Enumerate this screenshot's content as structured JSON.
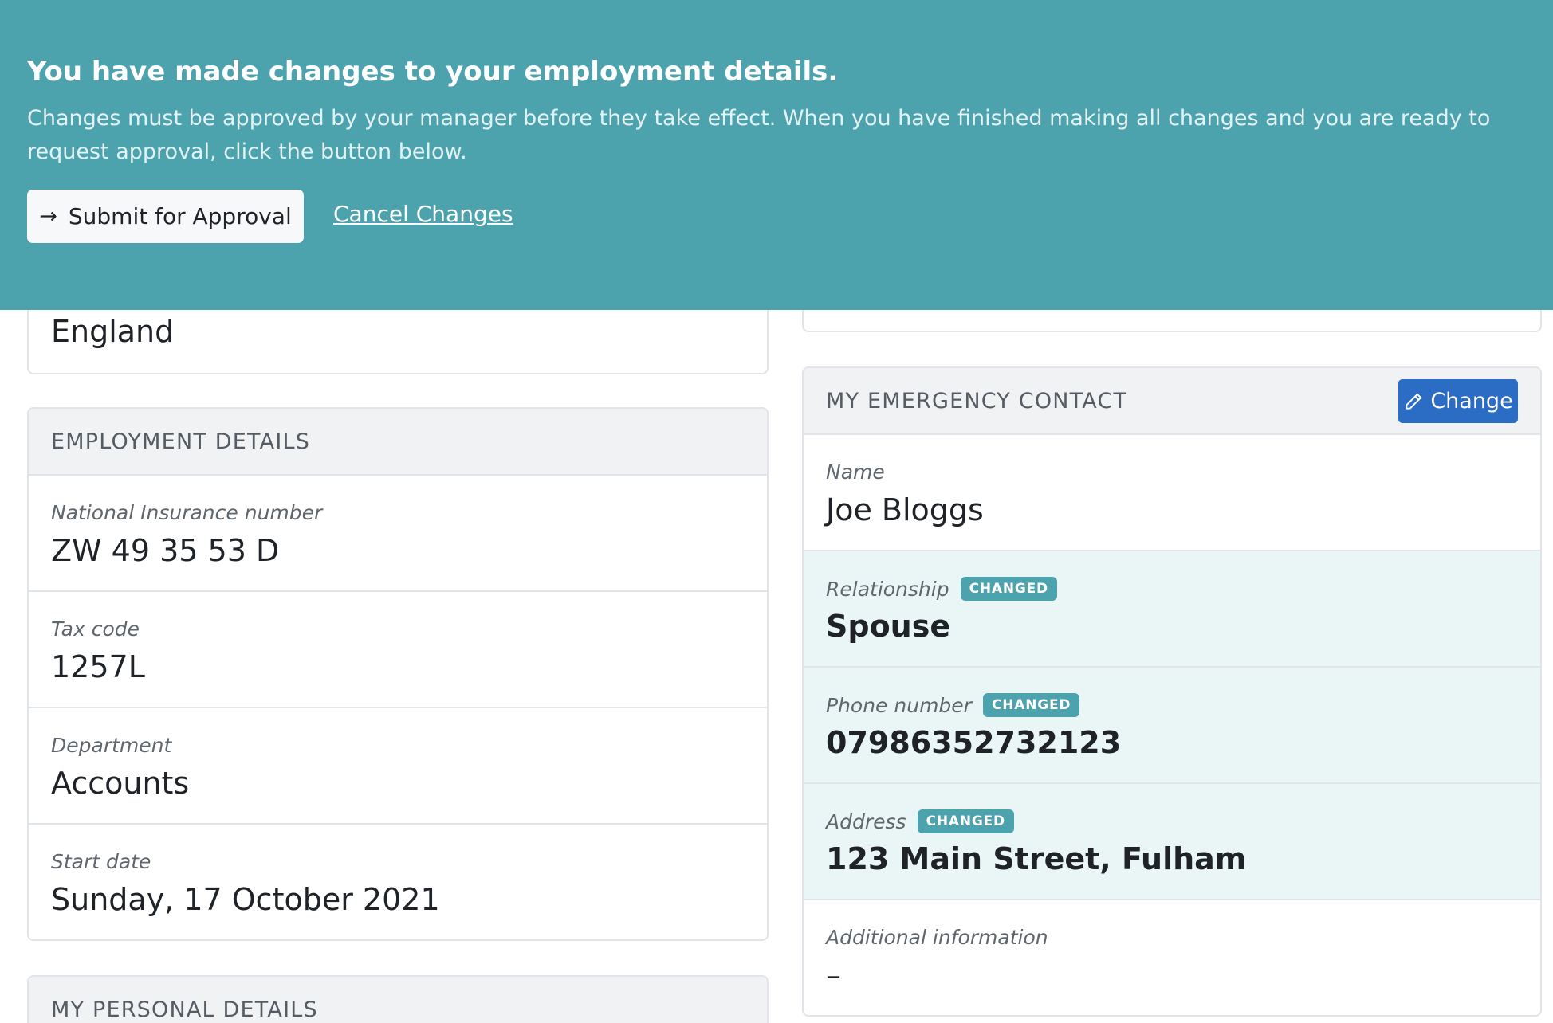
{
  "banner": {
    "title": "You have made changes to your employment details.",
    "body": "Changes must be approved by your manager before they take effect. When you have finished making all changes and you are ready to request approval, click the button below.",
    "submit_label": "Submit for Approval",
    "submit_icon": "arrow-right-icon",
    "cancel_label": "Cancel Changes",
    "color": "#4ca3ae"
  },
  "address_card": {
    "last_value": "England"
  },
  "employment": {
    "header": "EMPLOYMENT DETAILS",
    "rows": [
      {
        "label": "National Insurance number",
        "value": "ZW 49 35 53 D"
      },
      {
        "label": "Tax code",
        "value": "1257L"
      },
      {
        "label": "Department",
        "value": "Accounts"
      },
      {
        "label": "Start date",
        "value": "Sunday, 17 October 2021"
      }
    ]
  },
  "personal": {
    "header": "MY PERSONAL DETAILS"
  },
  "emergency": {
    "header": "MY EMERGENCY CONTACT",
    "change_label": "Change",
    "change_icon": "pencil-icon",
    "change_color": "#2b6cc4",
    "badge_label": "CHANGED",
    "rows": [
      {
        "label": "Name",
        "value": "Joe Bloggs",
        "changed": false
      },
      {
        "label": "Relationship",
        "value": "Spouse",
        "changed": true
      },
      {
        "label": "Phone number",
        "value": "07986352732123",
        "changed": true
      },
      {
        "label": "Address",
        "value": "123 Main Street, Fulham",
        "changed": true
      },
      {
        "label": "Additional information",
        "value": "–",
        "changed": false
      }
    ]
  }
}
